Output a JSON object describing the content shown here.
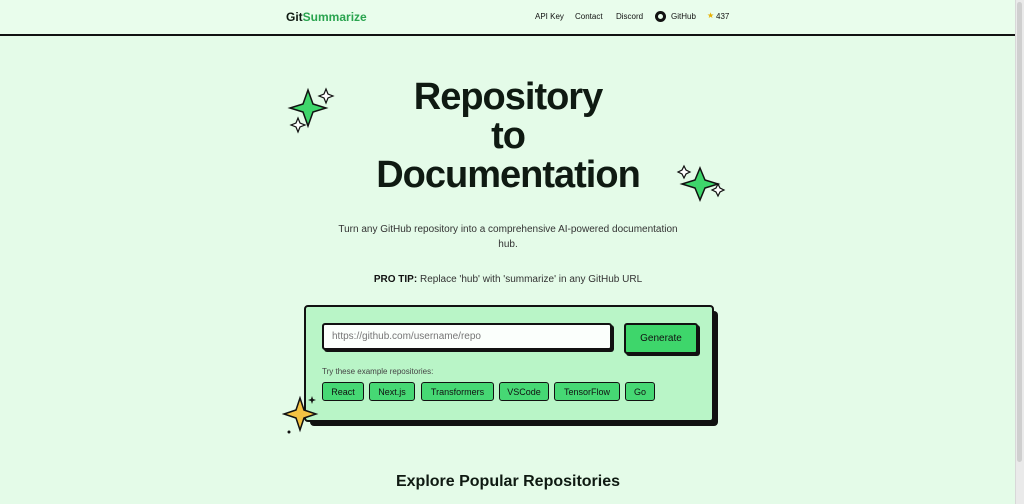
{
  "header": {
    "logo_part1": "Git",
    "logo_part2": "Summarize",
    "nav": {
      "api_key": "API Key",
      "contact": "Contact",
      "discord": "Discord",
      "github": "GitHub",
      "stars": "437"
    }
  },
  "hero": {
    "title_line1": "Repository",
    "title_line2": "to",
    "title_line3": "Documentation",
    "subtitle": "Turn any GitHub repository into a comprehensive AI-powered documentation hub.",
    "protip_label": "PRO TIP:",
    "protip_text": "Replace 'hub' with 'summarize' in any GitHub URL"
  },
  "form": {
    "input_placeholder": "https://github.com/username/repo",
    "generate_label": "Generate",
    "examples_label": "Try these example repositories:",
    "examples": [
      "React",
      "Next.js",
      "Transformers",
      "VSCode",
      "TensorFlow",
      "Go"
    ]
  },
  "explore_title": "Explore Popular Repositories",
  "colors": {
    "background": "#e4fbe8",
    "accent": "#3ed66b",
    "card": "#b9f5c7",
    "star_yellow": "#f5c242"
  }
}
